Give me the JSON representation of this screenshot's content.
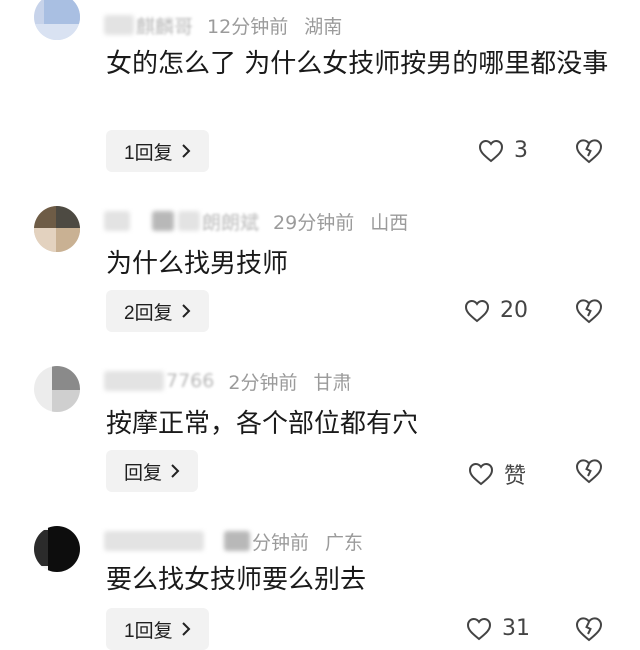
{
  "comments": [
    {
      "nickname": "麒麟哥",
      "time": "12分钟前",
      "region": "湖南",
      "content": "女的怎么了 为什么女技师按男的哪里都没事",
      "reply_label": "1回复",
      "likes": "3"
    },
    {
      "nickname": "朗朗斌",
      "time": "29分钟前",
      "region": "山西",
      "content": "为什么找男技师",
      "reply_label": "2回复",
      "likes": "20"
    },
    {
      "nickname": "7766",
      "time": "2分钟前",
      "region": "甘肃",
      "content": "按摩正常，各个部位都有穴",
      "reply_label": "回复",
      "likes": "赞"
    },
    {
      "nickname": "",
      "time": "分钟前",
      "region": "广东",
      "content": "要么找女技师要么别去",
      "reply_label": "1回复",
      "likes": "31"
    }
  ],
  "icons": {
    "like": "heart-outline-icon",
    "dislike": "broken-heart-icon",
    "chevron": "chevron-right-icon"
  }
}
